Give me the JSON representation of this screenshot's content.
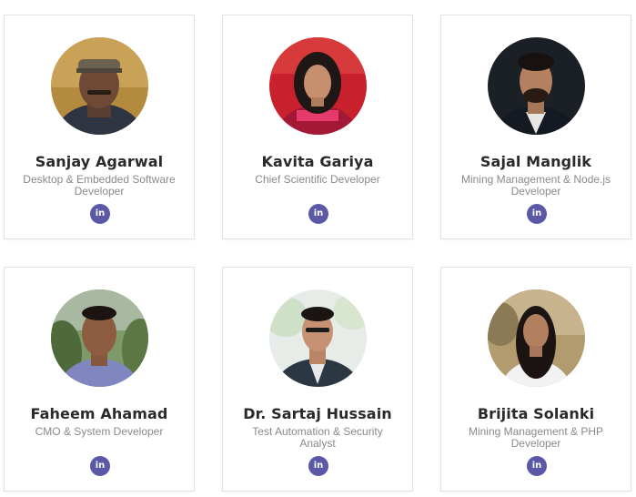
{
  "team": [
    {
      "name": "Sanjay Agarwal",
      "role": "Desktop & Embedded Software Developer",
      "link_icon": "linkedin-icon",
      "link_label": "in"
    },
    {
      "name": "Kavita Gariya",
      "role": "Chief Scientific Developer",
      "link_icon": "linkedin-icon",
      "link_label": "in"
    },
    {
      "name": "Sajal Manglik",
      "role": "Mining Management & Node.js Developer",
      "link_icon": "linkedin-icon",
      "link_label": "in"
    },
    {
      "name": "Faheem Ahamad",
      "role": "CMO & System Developer",
      "link_icon": "linkedin-icon",
      "link_label": "in"
    },
    {
      "name": "Dr. Sartaj Hussain",
      "role": "Test Automation & Security Analyst",
      "link_icon": "linkedin-icon",
      "link_label": "in"
    },
    {
      "name": "Brijita Solanki",
      "role": "Mining Management & PHP Developer",
      "link_icon": "linkedin-icon",
      "link_label": "in"
    }
  ],
  "colors": {
    "linkedin_button": "#5a59a8",
    "name_text": "#2a2a2a",
    "role_text": "#8a8a8a",
    "card_border": "#e2e2e2"
  }
}
